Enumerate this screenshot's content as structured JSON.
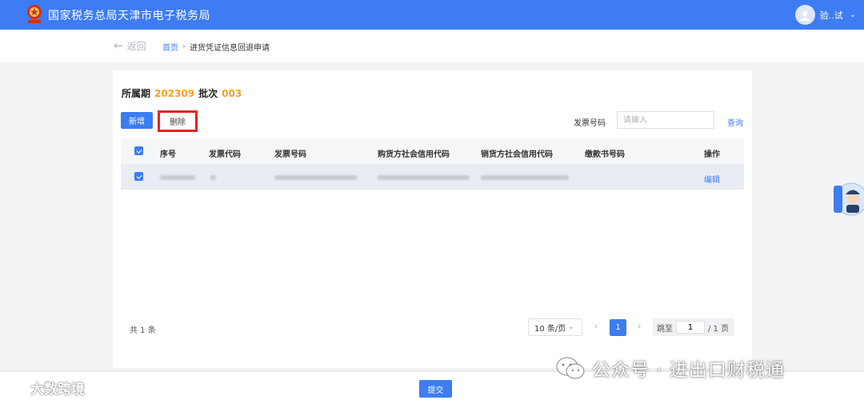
{
  "header": {
    "site_title": "国家税务总局天津市电子税务局",
    "user_name": "验..试",
    "brand_color": "#3d7cf2"
  },
  "nav": {
    "back_label": "返回",
    "breadcrumb": [
      "首页",
      "进货凭证信息回退申请"
    ]
  },
  "period": {
    "label": "所属期",
    "value": "202309",
    "batch_label": "批次",
    "batch_value": "003"
  },
  "toolbar": {
    "add_label": "新增",
    "delete_label": "删除",
    "search_label": "发票号码",
    "search_placeholder": "请输入",
    "query_label": "查询"
  },
  "table": {
    "columns": [
      "序号",
      "发票代码",
      "发票号码",
      "购货方社会信用代码",
      "销货方社会信用代码",
      "缴款书号码",
      "操作"
    ],
    "rows": [
      {
        "checked": true,
        "action": "编辑"
      }
    ]
  },
  "pagination": {
    "total": "共 1 条",
    "page_size": "10 条/页",
    "current_page": "1",
    "jump_label": "跳至",
    "jump_value": "1",
    "total_pages": "/ 1 页"
  },
  "footer": {
    "submit_label": "提交"
  },
  "watermarks": {
    "left": "大数跨境",
    "right": "公众号 · 进出口财税通"
  }
}
